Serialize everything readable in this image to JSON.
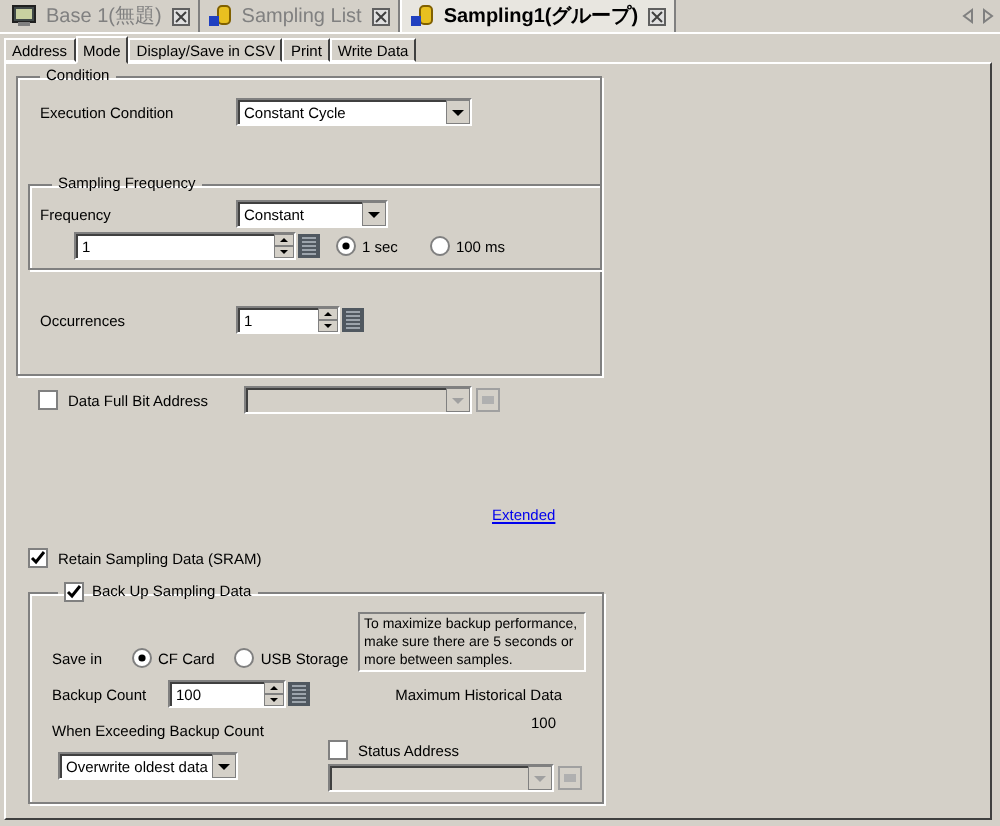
{
  "document_tabs": [
    {
      "label": "Base 1(無題)",
      "kind": "screen",
      "selected": false
    },
    {
      "label": "Sampling List",
      "kind": "sampling",
      "selected": false
    },
    {
      "label": "Sampling1(グループ)",
      "kind": "sampling",
      "selected": true
    }
  ],
  "settings_tabs": [
    {
      "label": "Address",
      "selected": false
    },
    {
      "label": "Mode",
      "selected": true
    },
    {
      "label": "Display/Save in CSV",
      "selected": false
    },
    {
      "label": "Print",
      "selected": false
    },
    {
      "label": "Write Data",
      "selected": false
    }
  ],
  "condition": {
    "title": "Condition",
    "execution_condition": {
      "label": "Execution Condition",
      "value": "Constant Cycle"
    },
    "sampling_frequency": {
      "title": "Sampling Frequency",
      "frequency": {
        "label": "Frequency",
        "value": "Constant"
      },
      "interval_value": "1",
      "units": [
        {
          "label": "1 sec",
          "selected": true
        },
        {
          "label": "100 ms",
          "selected": false
        }
      ]
    },
    "occurrences": {
      "label": "Occurrences",
      "value": "1"
    }
  },
  "data_full_bit_address": {
    "label": "Data Full Bit Address",
    "checked": false
  },
  "extended_link": "Extended",
  "retain_sampling_data": {
    "label": "Retain Sampling Data (SRAM)",
    "checked": true
  },
  "backup": {
    "label": "Back Up Sampling Data",
    "checked": true,
    "save_in": {
      "label": "Save in",
      "options": [
        {
          "label": "CF Card",
          "selected": true
        },
        {
          "label": "USB Storage",
          "selected": false
        }
      ]
    },
    "note": "To maximize backup performance, make sure there are 5 seconds or more between samples.",
    "backup_count": {
      "label": "Backup Count",
      "value": "100"
    },
    "max_historical": {
      "label": "Maximum Historical Data",
      "value": "100"
    },
    "when_exceeding": {
      "label": "When Exceeding Backup Count",
      "value": "Overwrite oldest data"
    },
    "status_address": {
      "label": "Status Address",
      "checked": false
    }
  }
}
